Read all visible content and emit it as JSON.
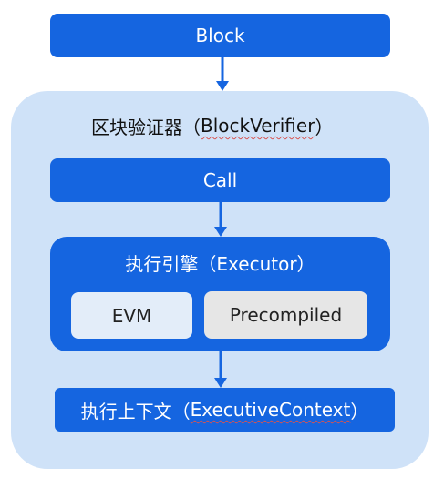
{
  "block": {
    "label": "Block"
  },
  "verifier": {
    "label_prefix": "区块验证器（",
    "label_en": "BlockVerifier",
    "label_suffix": "）"
  },
  "call": {
    "label": "Call"
  },
  "executor": {
    "label": "执行引擎（Executor）",
    "evm_label": "EVM",
    "precompiled_label": "Precompiled"
  },
  "context": {
    "label_prefix": "执行上下文（",
    "label_en": "ExecutiveContext",
    "label_suffix": "）"
  },
  "colors": {
    "primary_blue": "#1565e0",
    "container_light_blue": "#cfe2f8",
    "evm_bg": "#e3edf9",
    "precompiled_bg": "#e6e6e6",
    "arrow": "#1565e0"
  }
}
